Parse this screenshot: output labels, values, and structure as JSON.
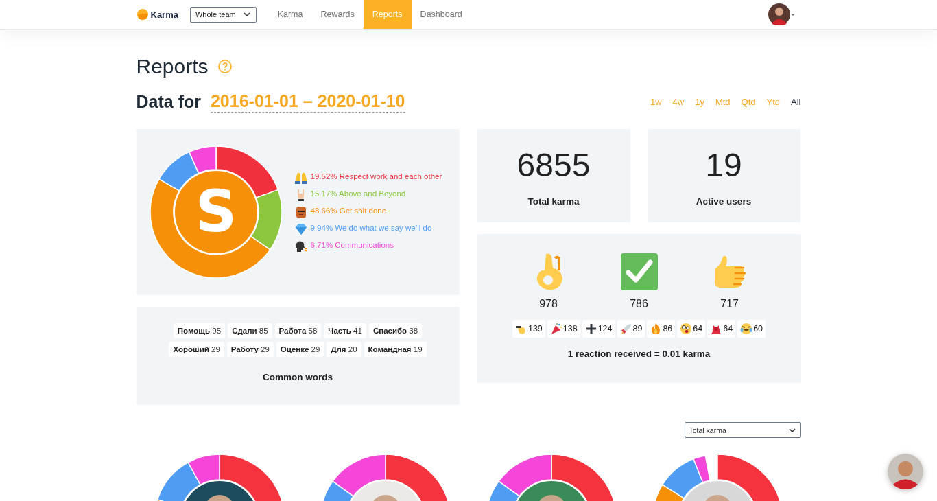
{
  "nav": {
    "brand": "Karma",
    "team_select": "Whole team",
    "tabs": [
      {
        "label": "Karma",
        "selected": false
      },
      {
        "label": "Rewards",
        "selected": false
      },
      {
        "label": "Reports",
        "selected": true
      },
      {
        "label": "Dashboard",
        "selected": false
      }
    ]
  },
  "page": {
    "title": "Reports"
  },
  "date_range": {
    "prefix": "Data for",
    "range": "2016-01-01 – 2020-01-10",
    "periods": [
      {
        "label": "1w",
        "selected": false
      },
      {
        "label": "4w",
        "selected": false
      },
      {
        "label": "1y",
        "selected": false
      },
      {
        "label": "Mtd",
        "selected": false
      },
      {
        "label": "Qtd",
        "selected": false
      },
      {
        "label": "Ytd",
        "selected": false
      },
      {
        "label": "All",
        "selected": true
      }
    ]
  },
  "values_chart": {
    "logo_letter": "S",
    "chart_data": {
      "type": "donut",
      "categories": [
        "Respect work and each other",
        "Above and Beyond",
        "Get shit done",
        "We do what we say we’ll do",
        "Communications"
      ],
      "values": [
        19.52,
        15.17,
        48.66,
        9.94,
        6.71
      ],
      "value_labels": [
        "19.52%",
        "15.17%",
        "48.66%",
        "9.94%",
        "6.71%"
      ]
    },
    "legend": [
      {
        "color": "#f0313d"
      },
      {
        "color": "#8cc63f"
      },
      {
        "color": "#f79009"
      },
      {
        "color": "#4f9cf5"
      },
      {
        "color": "#f446d9"
      }
    ]
  },
  "stats": [
    {
      "value": "6855",
      "label": "Total karma"
    },
    {
      "value": "19",
      "label": "Active users"
    }
  ],
  "reactions": {
    "top": [
      {
        "count": "978"
      },
      {
        "count": "786"
      },
      {
        "count": "717"
      }
    ],
    "others": [
      {
        "count": "139"
      },
      {
        "count": "138"
      },
      {
        "count": "124"
      },
      {
        "count": "89"
      },
      {
        "count": "86"
      },
      {
        "count": "64"
      },
      {
        "count": "64"
      },
      {
        "count": "60"
      }
    ],
    "note": "1 reaction received = 0.01 karma"
  },
  "common_words": {
    "words": [
      {
        "word": "Помощь",
        "count": "95"
      },
      {
        "word": "Сдали",
        "count": "85"
      },
      {
        "word": "Работа",
        "count": "58"
      },
      {
        "word": "Часть",
        "count": "41"
      },
      {
        "word": "Спасибо",
        "count": "38"
      },
      {
        "word": "Хороший",
        "count": "29"
      },
      {
        "word": "Работу",
        "count": "29"
      },
      {
        "word": "Оценке",
        "count": "29"
      },
      {
        "word": "Для",
        "count": "20"
      },
      {
        "word": "Командная",
        "count": "19"
      }
    ],
    "title": "Common words"
  },
  "user_charts": {
    "metric_select": "Total karma"
  }
}
